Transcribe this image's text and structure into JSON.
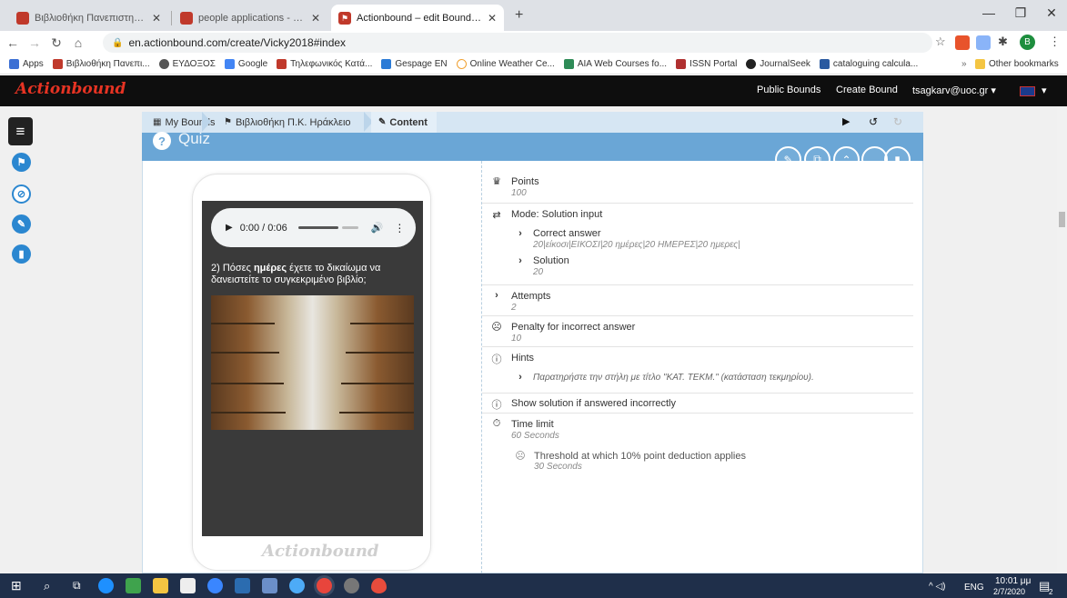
{
  "browser": {
    "tabs": [
      {
        "title": "Βιβλιοθήκη Πανεπιστημίου Κρήτ",
        "color": "#c0392b"
      },
      {
        "title": "people applications - Edit - Word",
        "color": "#c0392b"
      },
      {
        "title": "Actionbound – edit Bound | Crea",
        "color": "#c0392b"
      }
    ],
    "new_tab": "+",
    "url": "en.actionbound.com/create/Vicky2018#index",
    "profile_initial": "B",
    "bookmarks": [
      {
        "label": "Apps",
        "color": "#3b6fd4"
      },
      {
        "label": "Βιβλιοθήκη Πανεπι...",
        "color": "#c0392b"
      },
      {
        "label": "ΕΥΔΟΞΟΣ",
        "color": "#555"
      },
      {
        "label": "Google",
        "color": "#4285f4"
      },
      {
        "label": "Τηλεφωνικός Κατά...",
        "color": "#c0392b"
      },
      {
        "label": "Gespage EN",
        "color": "#2b7bd6"
      },
      {
        "label": "Online Weather Ce...",
        "color": "#f0a030"
      },
      {
        "label": "AIA Web Courses fo...",
        "color": "#2e8b57"
      },
      {
        "label": "ISSN Portal",
        "color": "#b03030"
      },
      {
        "label": "JournalSeek",
        "color": "#222"
      },
      {
        "label": "cataloguing calcula...",
        "color": "#2a5aa0"
      }
    ],
    "bookmarks_more": "»",
    "other_bookmarks": "Other bookmarks"
  },
  "app": {
    "logo": "Actionbound",
    "nav": [
      "Public Bounds",
      "Create Bound"
    ],
    "user": "tsagkarv@uoc.gr ▾",
    "lang_menu": "▾"
  },
  "breadcrumb": {
    "items": [
      "My Bounds",
      "Βιβλιοθήκη Π.Κ. Ηράκλειο",
      "Content"
    ]
  },
  "quiz": {
    "title": "Quiz",
    "audio_time": "0:00 / 0:06",
    "question_prefix": "2) Πόσες ",
    "question_bold": "ημέρες",
    "question_suffix": " έχετε το δικαίωμα να δανειστείτε το συγκεκριμένο βιβλίο;",
    "brand": "Actionbound"
  },
  "settings": {
    "points_label": "Points",
    "points_value": "100",
    "mode_label": "Mode: Solution input",
    "correct_label": "Correct answer",
    "correct_value": "20|είκοσι|ΕΙΚΟΣΙ|20 ημέρες|20 ΗΜΕΡΕΣ|20 ημερες|",
    "solution_label": "Solution",
    "solution_value": "20",
    "attempts_label": "Attempts",
    "attempts_value": "2",
    "penalty_label": "Penalty for incorrect answer",
    "penalty_value": "10",
    "hints_label": "Hints",
    "hint_value": "Παρατηρήστε την στήλη με τίτλο \"ΚΑΤ. ΤΕΚΜ.\" (κατάσταση τεκμηρίου).",
    "show_solution_label": "Show solution if answered incorrectly",
    "time_limit_label": "Time limit",
    "time_limit_value": "60 Seconds",
    "threshold_label": "Threshold at which 10% point deduction applies",
    "threshold_value": "30 Seconds"
  },
  "taskbar": {
    "lang": "ENG",
    "time": "10:01 μμ",
    "date": "2/7/2020",
    "notif_count": "2"
  },
  "colors": {
    "accent": "#6aa6d6",
    "header_bg": "#0e0e0e",
    "logo": "#e63323",
    "taskbar": "#1f2f4a"
  }
}
